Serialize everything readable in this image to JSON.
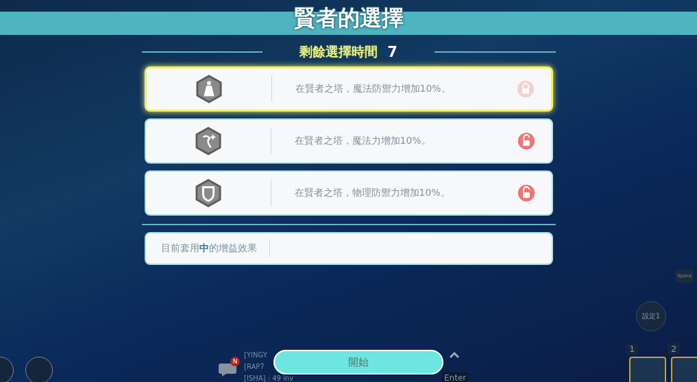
{
  "title": "賢者的選擇",
  "timer": {
    "label": "剩餘選擇時間",
    "value": "7"
  },
  "options": [
    {
      "kind": "robe",
      "text": "在賢者之塔，魔法防禦力增加10%。",
      "selected": true,
      "locked": true
    },
    {
      "kind": "staff",
      "text": "在賢者之塔，魔法力增加10%。",
      "selected": false,
      "locked": false
    },
    {
      "kind": "shield",
      "text": "在賢者之塔，物理防禦力增加10%。",
      "selected": false,
      "locked": false
    }
  ],
  "current_buff": {
    "label": "目前套用**中**的增益效果"
  },
  "start_button": "開始",
  "hud": {
    "chat_lines": [
      "[YINGY",
      "[RAP7",
      "[ISHA] : 49 inv"
    ],
    "chat_badge": "N",
    "enter_key": "Enter",
    "preset_button": "設定1",
    "space_key": "Space",
    "slots": [
      "1",
      "2"
    ]
  }
}
